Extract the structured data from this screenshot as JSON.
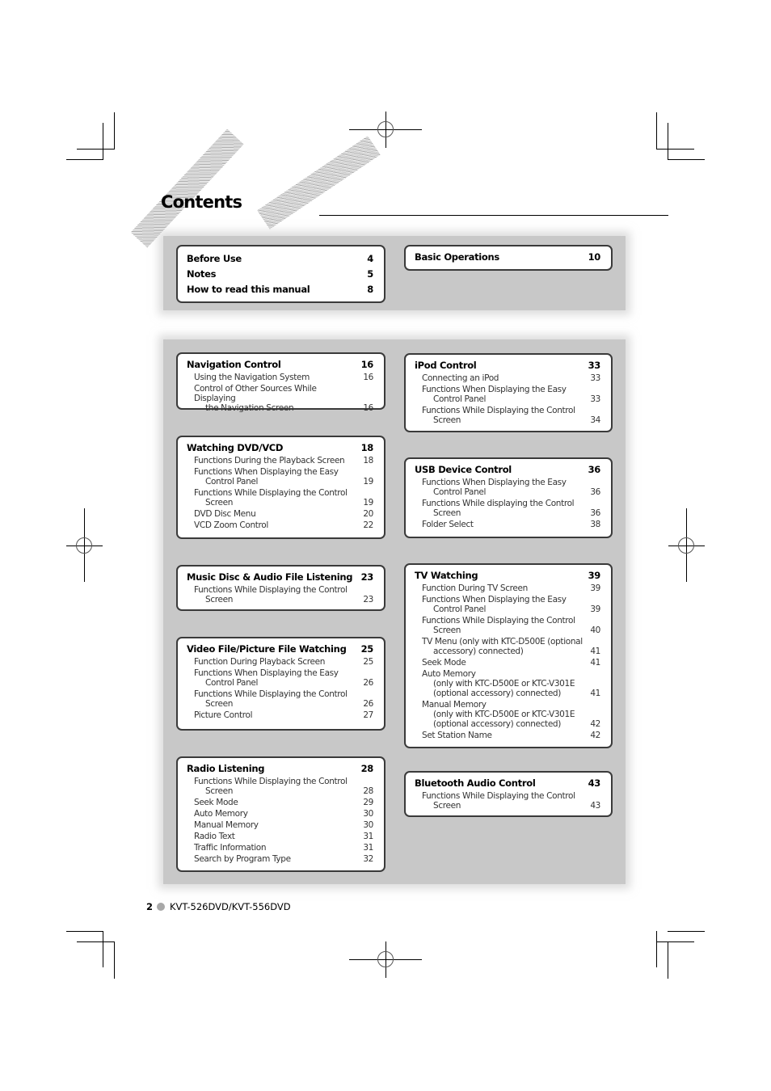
{
  "page": {
    "title": "Contents",
    "footer": {
      "page_number": "2",
      "model": "KVT-526DVD/KVT-556DVD"
    }
  },
  "top_sections": {
    "left": [
      {
        "label": "Before Use",
        "page": "4"
      },
      {
        "label": "Notes",
        "page": "5"
      },
      {
        "label": "How to read this manual",
        "page": "8"
      }
    ],
    "right": [
      {
        "label": "Basic Operations",
        "page": "10"
      }
    ]
  },
  "sections": {
    "navigation": {
      "title": "Navigation Control",
      "page": "16",
      "items": [
        {
          "label": "Using the Navigation System",
          "cont": "",
          "page": "16"
        },
        {
          "label": "Control of Other Sources While Displaying",
          "cont": "the Navigation Screen",
          "page": "16"
        }
      ]
    },
    "dvd": {
      "title": "Watching DVD/VCD",
      "page": "18",
      "items": [
        {
          "label": "Functions During the Playback Screen",
          "cont": "",
          "page": "18"
        },
        {
          "label": "Functions When Displaying the Easy",
          "cont": "Control Panel",
          "page": "19"
        },
        {
          "label": "Functions While Displaying the Control",
          "cont": "Screen",
          "page": "19"
        },
        {
          "label": "DVD Disc Menu",
          "cont": "",
          "page": "20"
        },
        {
          "label": "VCD Zoom Control",
          "cont": "",
          "page": "22"
        }
      ]
    },
    "music": {
      "title": "Music Disc & Audio File Listening",
      "page": "23",
      "items": [
        {
          "label": "Functions While Displaying the Control",
          "cont": "Screen",
          "page": "23"
        }
      ]
    },
    "video": {
      "title": "Video File/Picture File Watching",
      "page": "25",
      "items": [
        {
          "label": "Function During Playback Screen",
          "cont": "",
          "page": "25"
        },
        {
          "label": "Functions When Displaying the Easy",
          "cont": "Control Panel",
          "page": "26"
        },
        {
          "label": "Functions While Displaying the Control",
          "cont": "Screen",
          "page": "26"
        },
        {
          "label": "Picture Control",
          "cont": "",
          "page": "27"
        }
      ]
    },
    "radio": {
      "title": "Radio Listening",
      "page": "28",
      "items": [
        {
          "label": "Functions While Displaying the Control",
          "cont": "Screen",
          "page": "28"
        },
        {
          "label": "Seek Mode",
          "cont": "",
          "page": "29"
        },
        {
          "label": "Auto Memory",
          "cont": "",
          "page": "30"
        },
        {
          "label": "Manual Memory",
          "cont": "",
          "page": "30"
        },
        {
          "label": "Radio Text",
          "cont": "",
          "page": "31"
        },
        {
          "label": "Traffic Information",
          "cont": "",
          "page": "31"
        },
        {
          "label": "Search by Program Type",
          "cont": "",
          "page": "32"
        }
      ]
    },
    "ipod": {
      "title": "iPod Control",
      "page": "33",
      "items": [
        {
          "label": "Connecting an iPod",
          "cont": "",
          "page": "33"
        },
        {
          "label": "Functions When Displaying the Easy",
          "cont": "Control Panel",
          "page": "33"
        },
        {
          "label": "Functions While Displaying the Control",
          "cont": "Screen",
          "page": "34"
        }
      ]
    },
    "usb": {
      "title": "USB Device Control",
      "page": "36",
      "items": [
        {
          "label": "Functions When Displaying the Easy",
          "cont": "Control Panel",
          "page": "36"
        },
        {
          "label": "Functions While displaying the Control",
          "cont": "Screen",
          "page": "36"
        },
        {
          "label": "Folder Select",
          "cont": "",
          "page": "38"
        }
      ]
    },
    "tv": {
      "title": "TV Watching",
      "page": "39",
      "items": [
        {
          "label": "Function During TV Screen",
          "cont": "",
          "page": "39"
        },
        {
          "label": "Functions When Displaying the Easy",
          "cont": "Control Panel",
          "page": "39"
        },
        {
          "label": "Functions While Displaying the Control",
          "cont": "Screen",
          "page": "40"
        },
        {
          "label": "TV Menu (only with KTC-D500E (optional",
          "cont": "accessory) connected)",
          "page": "41"
        },
        {
          "label": "Seek Mode",
          "cont": "",
          "page": "41"
        },
        {
          "label": "Auto Memory",
          "cont": "(only with KTC-D500E or KTC-V301E\n(optional accessory) connected)",
          "page": "41"
        },
        {
          "label": "Manual Memory",
          "cont": "(only with KTC-D500E or KTC-V301E\n(optional accessory) connected)",
          "page": "42"
        },
        {
          "label": "Set Station Name",
          "cont": "",
          "page": "42"
        }
      ]
    },
    "bluetooth": {
      "title": "Bluetooth Audio Control",
      "page": "43",
      "items": [
        {
          "label": "Functions While Displaying the Control",
          "cont": "Screen",
          "page": "43"
        }
      ]
    }
  }
}
